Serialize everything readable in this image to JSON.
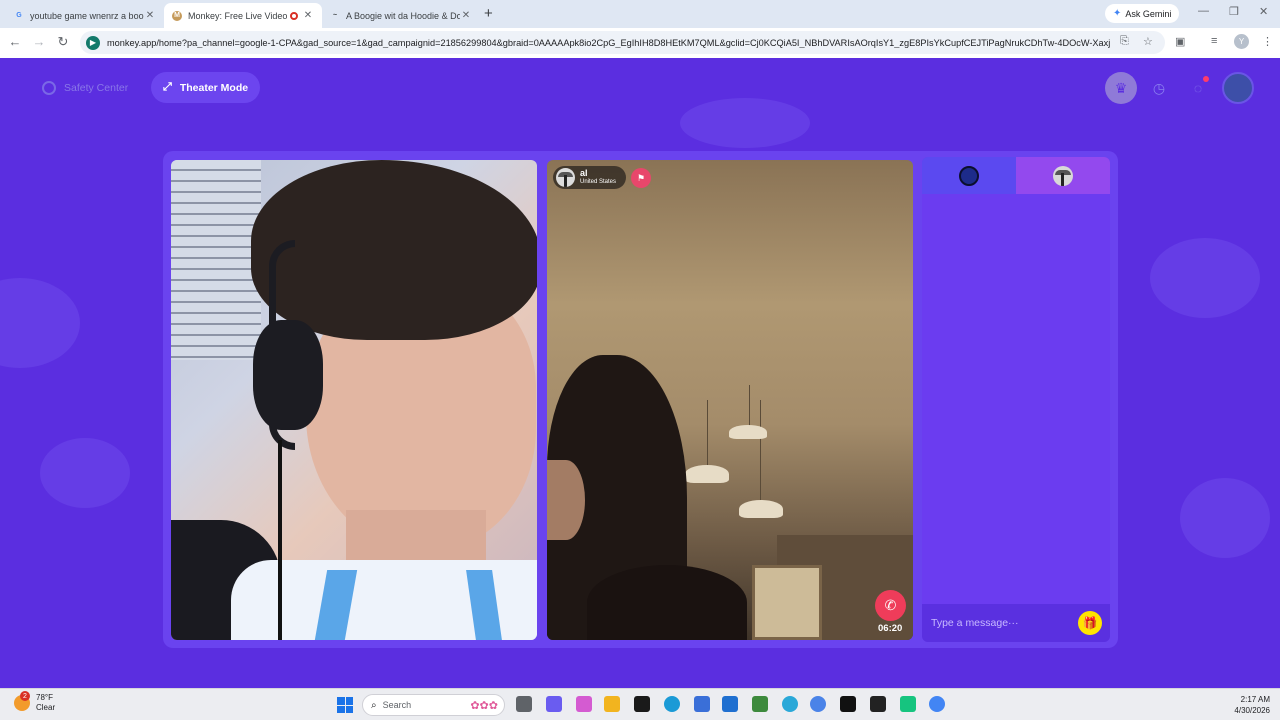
{
  "browser": {
    "tabs": [
      {
        "title": "youtube game wnenrz a boogie",
        "favicon": "G",
        "active": false
      },
      {
        "title": "Monkey: Free Live Video Ch",
        "favicon": "M",
        "active": true,
        "recording": true
      },
      {
        "title": "A Boogie wit da Hoodie & Don",
        "favicon": "~",
        "active": false
      }
    ],
    "new_tab_label": "+",
    "ask_gemini_label": "Ask Gemini",
    "address_url": "monkey.app/home?pa_channel=google-1-CPA&gad_source=1&gad_campaignid=21856299804&gbraid=0AAAAApk8io2CpG_EgIhIH8D8HEtKM7QML&gclid=Cj0KCQiA5I_NBhDVARIsAOrqIsY1_zgE8PIsYkCupfCEJTiPagNrukCDhTw-4DOcW-Xaxjr...",
    "profile_initial": "Y"
  },
  "app": {
    "safety_center_label": "Safety Center",
    "theater_mode_label": "Theater Mode",
    "remote_user": {
      "name": "al",
      "country": "United States"
    },
    "call_timer": "06:20",
    "chat": {
      "placeholder": "Type a message···"
    },
    "colors": {
      "background": "#5b2ee0",
      "end_call": "#ef3c5a",
      "gift": "#ffe400"
    }
  },
  "taskbar": {
    "weather_temp": "78°F",
    "weather_desc": "Clear",
    "weather_badge": "2",
    "search_label": "Search",
    "time": "2:17 AM",
    "date": "4/30/2026"
  }
}
